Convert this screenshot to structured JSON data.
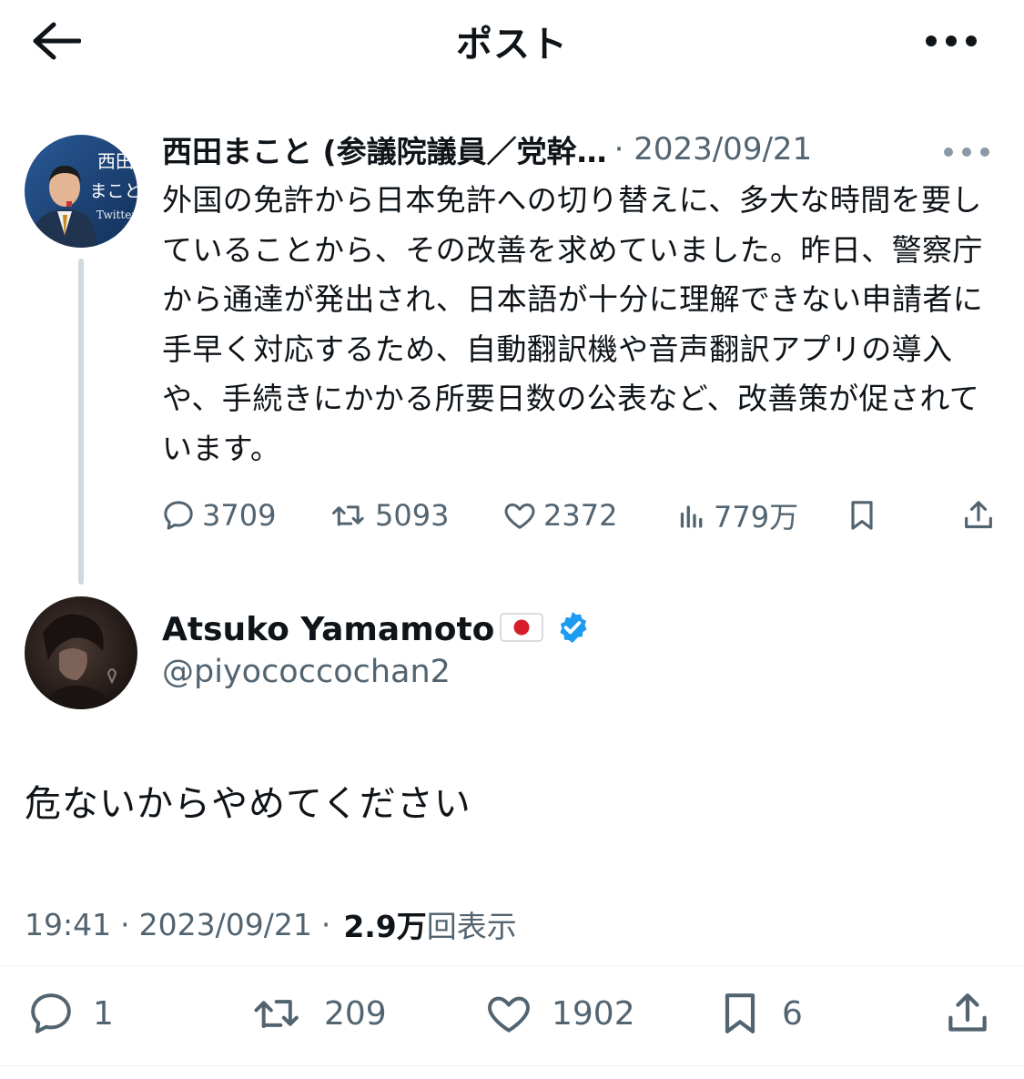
{
  "header": {
    "title": "ポスト",
    "back_icon": "arrow-left-icon",
    "more_icon": "more-horizontal-icon"
  },
  "parent_tweet": {
    "author_name": "西田まこと (参議院議員／党幹…",
    "separator": "·",
    "date": "2023/09/21",
    "avatar_text": [
      "西田",
      "まこと",
      "Twitter"
    ],
    "body": "外国の免許から日本免許への切り替えに、多大な時間を要していることから、その改善を求めていました。昨日、警察庁から通達が発出され、日本語が十分に理解できない申請者に手早く対応するため、自動翻訳機や音声翻訳アプリの導入や、手続きにかかる所要日数の公表など、改善策が促されています。",
    "stats": {
      "replies": "3709",
      "reposts": "5093",
      "likes": "2372",
      "views": "779万"
    }
  },
  "reply_tweet": {
    "author_name": "Atsuko Yamamoto",
    "handle": "@piyococcochan2",
    "body": "危ないからやめてください",
    "time": "19:41",
    "separator1": "·",
    "date": "2023/09/21",
    "separator2": "·",
    "views_count": "2.9万",
    "views_label": "回表示",
    "stats": {
      "replies": "1",
      "reposts": "209",
      "likes": "1902",
      "bookmarks": "6"
    }
  },
  "colors": {
    "text": "#0f1419",
    "secondary": "#536471",
    "verified": "#1d9bf0",
    "thread_line": "#cfd9de",
    "avatar_bg": "#1b3d6e"
  }
}
